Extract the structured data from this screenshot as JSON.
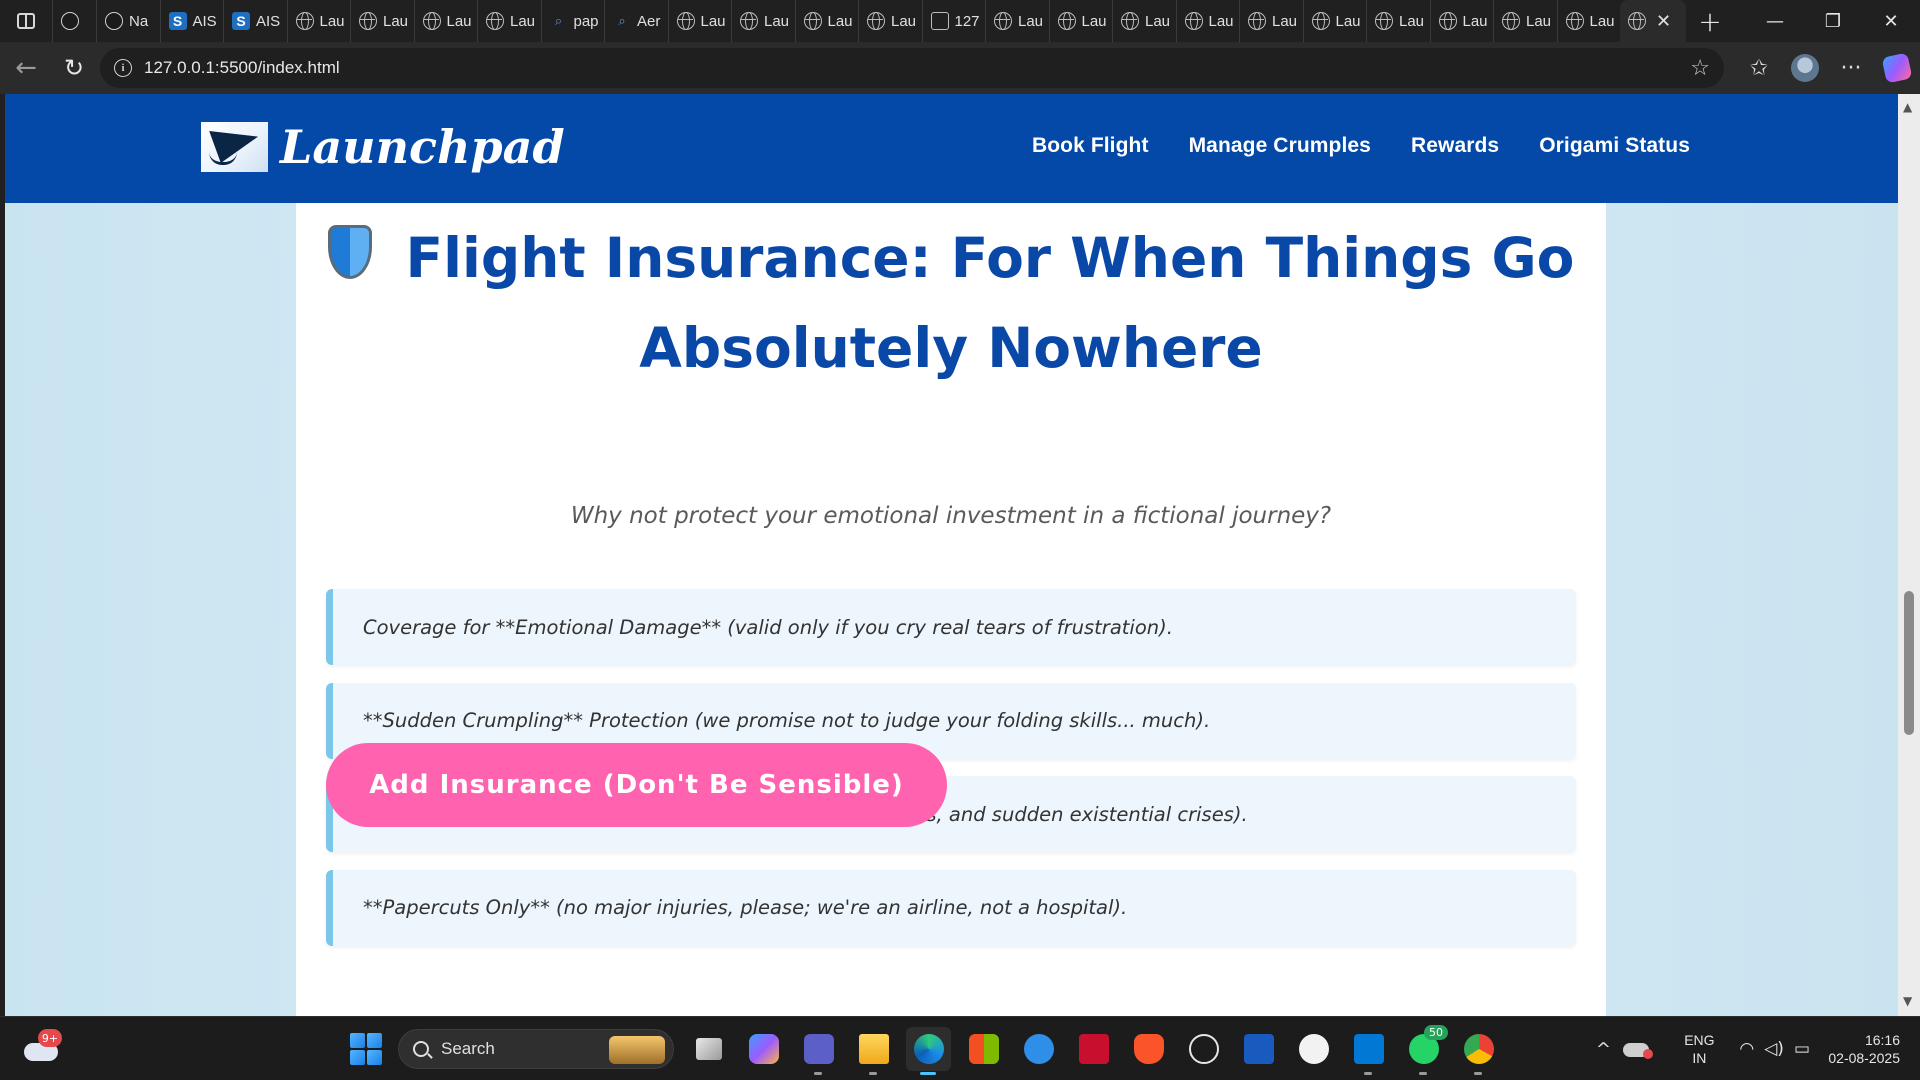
{
  "browser": {
    "tabs": [
      {
        "label": "",
        "icon": "github-icon"
      },
      {
        "label": "Na",
        "icon": "github-icon"
      },
      {
        "label": "AIS",
        "icon": "s-icon"
      },
      {
        "label": "AIS",
        "icon": "s-icon"
      },
      {
        "label": "Lau",
        "icon": "globe-icon"
      },
      {
        "label": "Lau",
        "icon": "globe-icon"
      },
      {
        "label": "Lau",
        "icon": "globe-icon"
      },
      {
        "label": "Lau",
        "icon": "globe-icon"
      },
      {
        "label": "pap",
        "icon": "search-icon"
      },
      {
        "label": "Aer",
        "icon": "search-icon"
      },
      {
        "label": "Lau",
        "icon": "globe-icon"
      },
      {
        "label": "Lau",
        "icon": "globe-icon"
      },
      {
        "label": "Lau",
        "icon": "globe-icon"
      },
      {
        "label": "Lau",
        "icon": "globe-icon"
      },
      {
        "label": "127",
        "icon": "document-icon"
      },
      {
        "label": "Lau",
        "icon": "globe-icon"
      },
      {
        "label": "Lau",
        "icon": "globe-icon"
      },
      {
        "label": "Lau",
        "icon": "globe-icon"
      },
      {
        "label": "Lau",
        "icon": "globe-icon"
      },
      {
        "label": "Lau",
        "icon": "globe-icon"
      },
      {
        "label": "Lau",
        "icon": "globe-icon"
      },
      {
        "label": "Lau",
        "icon": "globe-icon"
      },
      {
        "label": "Lau",
        "icon": "globe-icon"
      },
      {
        "label": "Lau",
        "icon": "globe-icon"
      },
      {
        "label": "Lau",
        "icon": "globe-icon"
      }
    ],
    "active_tab_icon": "globe-icon",
    "url": "127.0.0.1:5500/index.html"
  },
  "site": {
    "brand": "Launchpad",
    "nav": [
      "Book Flight",
      "Manage Crumples",
      "Rewards",
      "Origami Status"
    ],
    "title_line1": "Flight Insurance: For When Things Go",
    "title_line2": "Absolutely Nowhere",
    "subtitle": "Why not protect your emotional investment in a fictional journey?",
    "features": [
      "Coverage for **Emotional Damage** (valid only if you cry real tears of frustration).",
      "**Sudden Crumpling** Protection (we promise not to judge your folding skills... much).",
      "**Unexpected Gusts** Safeguard (includes sneezes, drafts, and sudden existential crises).",
      "**Papercuts Only** (no major injuries, please; we're an airline, not a hospital)."
    ],
    "cta": "Add Insurance (Don't Be Sensible)",
    "colors": {
      "header": "#0449a8",
      "title": "#0a48a8",
      "cta": "#ff63b0",
      "feature_bg": "#edf6fc",
      "feature_border": "#7cc6ea"
    }
  },
  "taskbar": {
    "weather_badge": "9+",
    "search_label": "Search",
    "whatsapp_badge": "50",
    "lang_line1": "ENG",
    "lang_line2": "IN",
    "time": "16:16",
    "date": "02-08-2025"
  }
}
